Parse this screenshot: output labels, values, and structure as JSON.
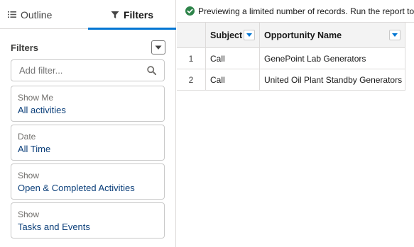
{
  "tabs": {
    "outline_label": "Outline",
    "filters_label": "Filters"
  },
  "filters_panel": {
    "title": "Filters",
    "add_filter_placeholder": "Add filter...",
    "cards": [
      {
        "label": "Show Me",
        "value": "All activities"
      },
      {
        "label": "Date",
        "value": "All Time"
      },
      {
        "label": "Show",
        "value": "Open & Completed Activities"
      },
      {
        "label": "Show",
        "value": "Tasks and Events"
      }
    ]
  },
  "preview": {
    "notice": "Previewing a limited number of records. Run the report to"
  },
  "table": {
    "columns": [
      "Subject",
      "Opportunity Name"
    ],
    "rows": [
      {
        "num": "1",
        "subject": "Call",
        "opportunity": "GenePoint Lab Generators"
      },
      {
        "num": "2",
        "subject": "Call",
        "opportunity": "United Oil Plant Standby Generators"
      }
    ]
  },
  "colors": {
    "accent": "#0176d3",
    "success": "#2e844a",
    "link_text": "#0b3f7a"
  },
  "icons": {
    "outline": "list-icon",
    "filters": "filter-icon",
    "search": "search-icon",
    "notice": "success-check-icon",
    "dropdown": "chevron-down-icon"
  }
}
